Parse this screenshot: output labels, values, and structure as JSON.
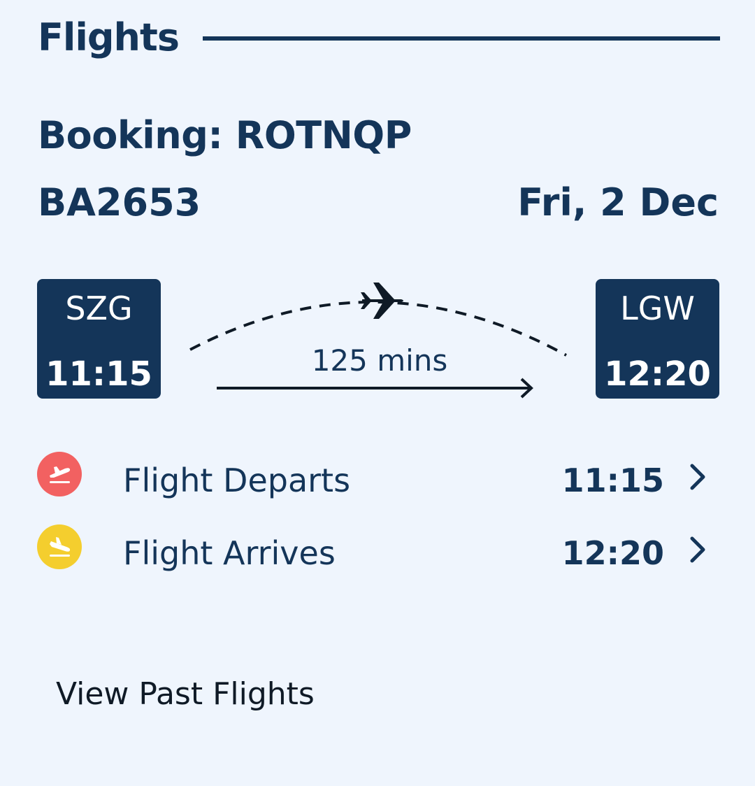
{
  "section": {
    "title": "Flights"
  },
  "booking": {
    "label": "Booking: ROTNQP"
  },
  "flight": {
    "number": "BA2653",
    "date": "Fri, 2 Dec",
    "duration": "125 mins",
    "origin": {
      "code": "SZG",
      "time": "11:15"
    },
    "destination": {
      "code": "LGW",
      "time": "12:20"
    }
  },
  "events": [
    {
      "label": "Flight Departs",
      "time": "11:15",
      "icon": "plane-takeoff-icon",
      "color": "#f26161"
    },
    {
      "label": "Flight Arrives",
      "time": "12:20",
      "icon": "plane-landing-icon",
      "color": "#f4ce2e"
    }
  ],
  "footer": {
    "past_flights_link": "View Past Flights"
  },
  "colors": {
    "primary": "#143559",
    "background": "#eff5fd",
    "depart": "#f26161",
    "arrive": "#f4ce2e"
  }
}
